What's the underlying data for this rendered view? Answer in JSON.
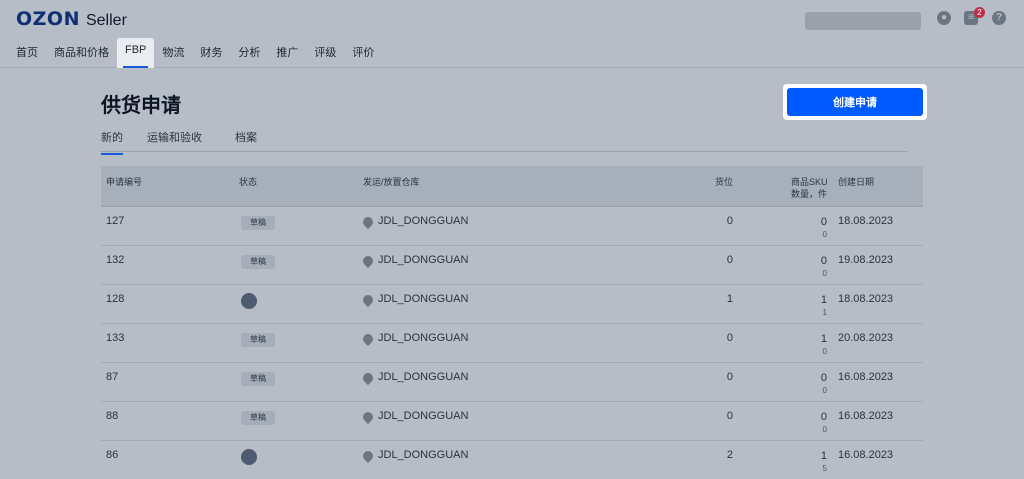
{
  "header": {
    "logo": "OZON",
    "logo_suffix": "Seller",
    "notification_count": "2",
    "icons": [
      "user-icon",
      "chat-icon",
      "help-icon"
    ],
    "nav": [
      "首页",
      "商品和价格",
      "FBP",
      "物流",
      "财务",
      "分析",
      "推广",
      "评级",
      "评价"
    ],
    "active_nav": "FBP"
  },
  "page": {
    "title": "供货申请",
    "create_button": "创建申请",
    "tabs": [
      "新的",
      "运输和验收",
      "档案"
    ],
    "active_tab": "新的"
  },
  "table": {
    "headers": {
      "id": "申请编号",
      "status": "状态",
      "warehouse": "发运/放置仓库",
      "slots": "货位",
      "sku": "商品SKU",
      "sku_sub": "数量，件",
      "date": "创建日期"
    },
    "rows": [
      {
        "id": "127",
        "status": "草稿",
        "status_type": "draft",
        "warehouse": "JDL_DONGGUAN",
        "slots": "0",
        "sku": "0",
        "qty": "0",
        "date": "18.08.2023"
      },
      {
        "id": "132",
        "status": "草稿",
        "status_type": "draft",
        "warehouse": "JDL_DONGGUAN",
        "slots": "0",
        "sku": "0",
        "qty": "0",
        "date": "19.08.2023"
      },
      {
        "id": "128",
        "status": "",
        "status_type": "dot",
        "warehouse": "JDL_DONGGUAN",
        "slots": "1",
        "sku": "1",
        "qty": "1",
        "date": "18.08.2023"
      },
      {
        "id": "133",
        "status": "草稿",
        "status_type": "draft",
        "warehouse": "JDL_DONGGUAN",
        "slots": "0",
        "sku": "1",
        "qty": "0",
        "date": "20.08.2023"
      },
      {
        "id": "87",
        "status": "草稿",
        "status_type": "draft",
        "warehouse": "JDL_DONGGUAN",
        "slots": "0",
        "sku": "0",
        "qty": "0",
        "date": "16.08.2023"
      },
      {
        "id": "88",
        "status": "草稿",
        "status_type": "draft",
        "warehouse": "JDL_DONGGUAN",
        "slots": "0",
        "sku": "0",
        "qty": "0",
        "date": "16.08.2023"
      },
      {
        "id": "86",
        "status": "",
        "status_type": "dot",
        "warehouse": "JDL_DONGGUAN",
        "slots": "2",
        "sku": "1",
        "qty": "5",
        "date": "16.08.2023"
      }
    ]
  },
  "colors": {
    "accent": "#005bff",
    "brand": "#0f2f73",
    "overlay_bg": "#b6bdc7",
    "badge": "#c0304a"
  }
}
